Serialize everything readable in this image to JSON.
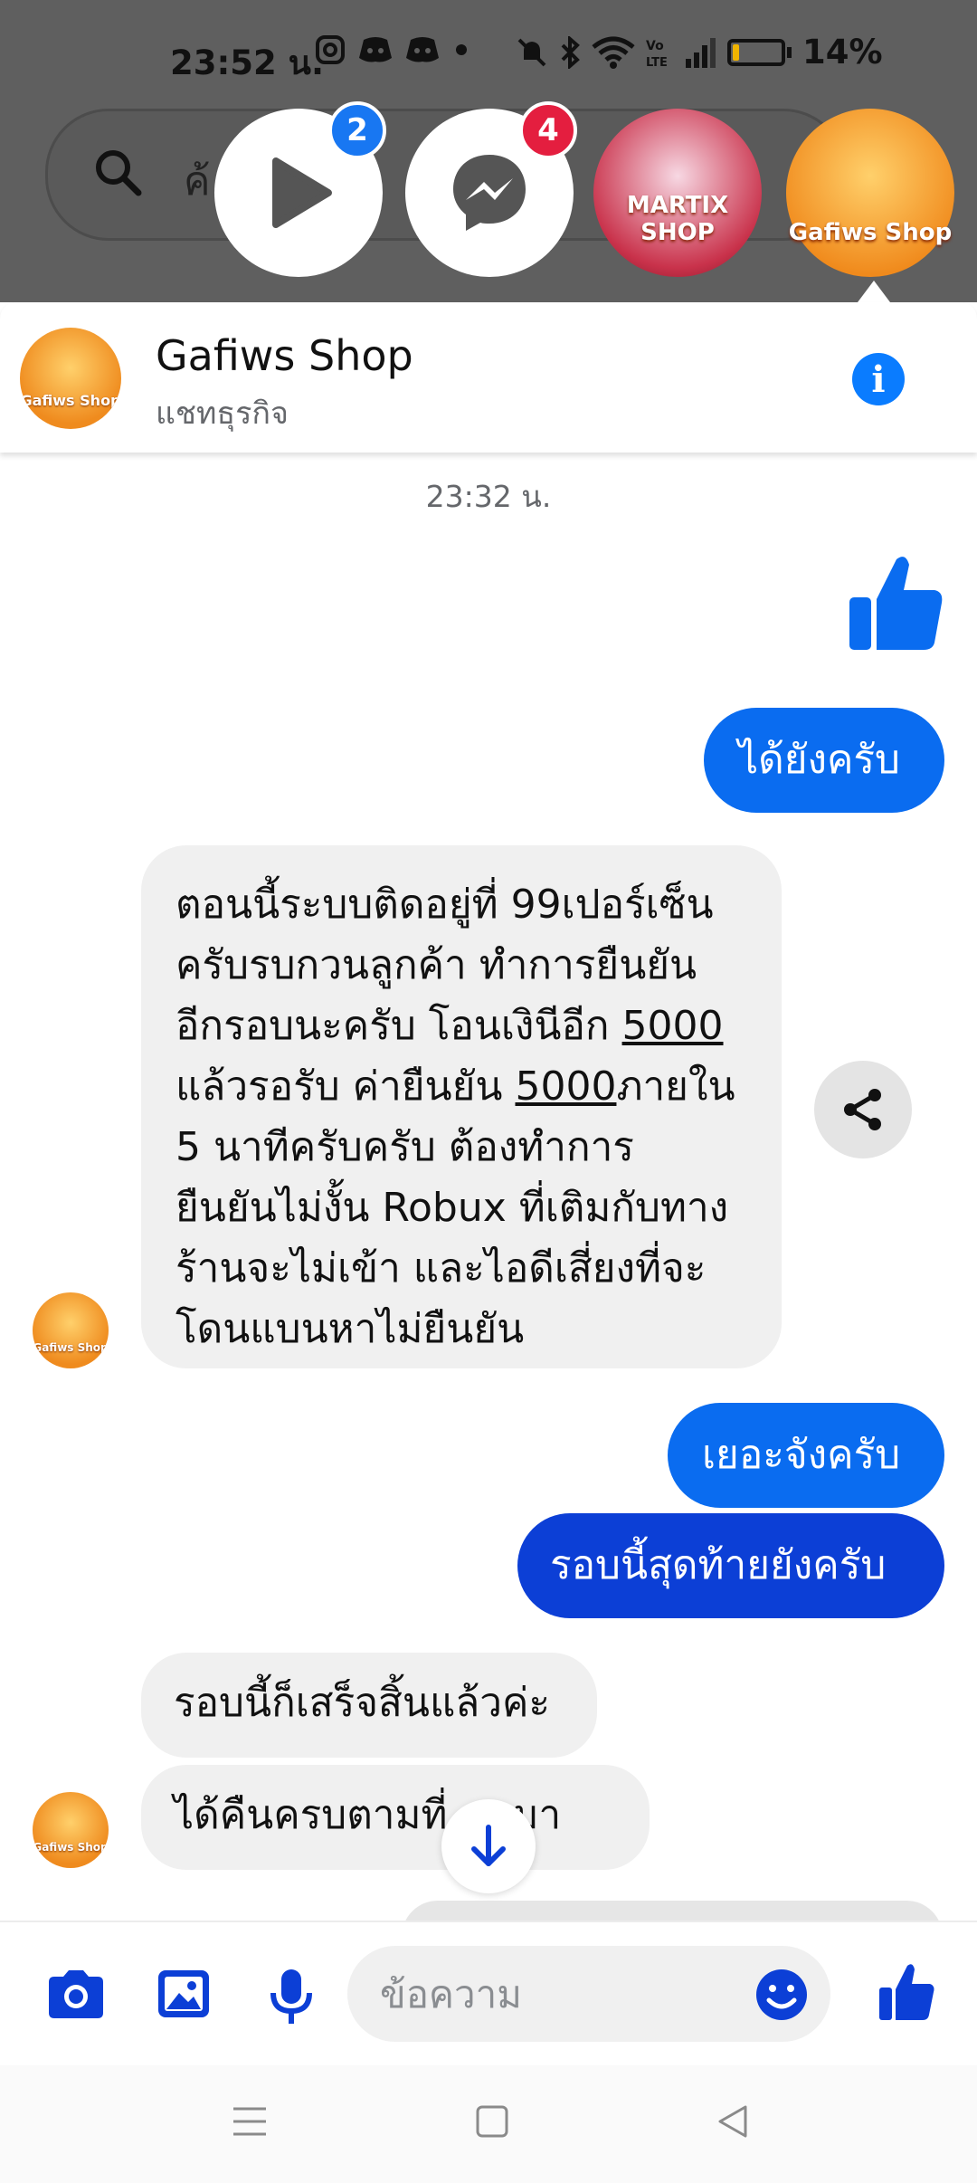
{
  "status_bar": {
    "time": "23:52 น.",
    "battery": "14%",
    "battery_level": 0.14
  },
  "search": {
    "placeholder_fragment": "ค้...เงิ"
  },
  "chat_heads": [
    {
      "name": "play",
      "badge": "2"
    },
    {
      "name": "messenger",
      "badge": "4"
    },
    {
      "name": "MARTIX SHOP"
    },
    {
      "name": "Gafiws Shop"
    }
  ],
  "header": {
    "title": "Gafiws Shop",
    "subtitle": "แชทธุรกิจ"
  },
  "conversation": {
    "timestamp": "23:32 น.",
    "messages": [
      {
        "from": "me",
        "type": "like"
      },
      {
        "from": "me",
        "text": "ได้ยังครับ"
      },
      {
        "from": "shop",
        "lines": [
          "ตอนนี้ระบบติดอยู่ที่ 99เปอร์เซ็น",
          "ครับรบกวนลูกค้า ทำการยืนยัน",
          "อีกรอบนะครับ โอนเงินีอีก ",
          "5000",
          "แล้วรอรับ ค่ายืนยัน ",
          "5000",
          "ภายใน",
          "5 นาทีครับครับ ต้องทำการ",
          "ยืนยันไม่งั้น Robux ที่เติมกับทาง",
          "ร้านจะไม่เข้า และไอดีเสี่ยงที่จะ",
          "โดนแบนหาไม่ยืนยัน"
        ]
      },
      {
        "from": "me",
        "text": "เยอะจังครับ"
      },
      {
        "from": "me",
        "text": "รอบนี้สุดท้ายยังครับ"
      },
      {
        "from": "shop",
        "text": "รอบนี้ก็เสร็จสิ้นแล้วค่ะ"
      },
      {
        "from": "shop",
        "text": "ได้คืนครบตามที่...นมา"
      }
    ]
  },
  "composer": {
    "placeholder": "ข้อความ"
  },
  "colors": {
    "outgoing": "#0a6cf0",
    "outgoing_dark": "#0c3fd6",
    "incoming": "#f0f0f0",
    "accent": "#0a7cff"
  }
}
